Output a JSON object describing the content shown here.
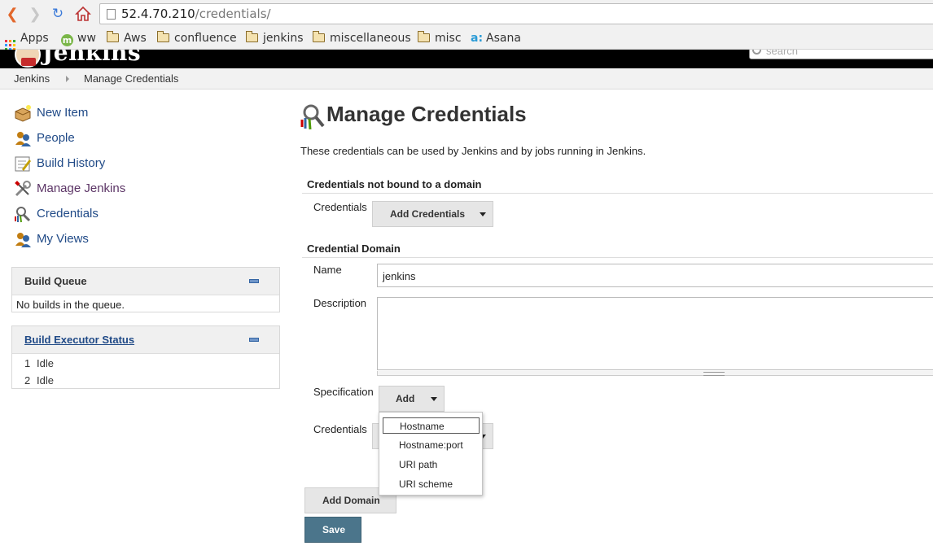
{
  "browser": {
    "url_host": "52.4.70.210",
    "url_path": "/credentials/",
    "bookmarks": [
      {
        "label": "Apps",
        "icon": "apps-grid-icon"
      },
      {
        "label": "ww",
        "icon": "m-icon"
      },
      {
        "label": "Aws",
        "icon": "folder-icon"
      },
      {
        "label": "confluence",
        "icon": "folder-icon"
      },
      {
        "label": "jenkins",
        "icon": "folder-icon"
      },
      {
        "label": "miscellaneous",
        "icon": "folder-icon"
      },
      {
        "label": "misc",
        "icon": "folder-icon"
      },
      {
        "label": "Asana",
        "icon": "asana-icon"
      }
    ]
  },
  "header": {
    "logo_text": "Jenkins",
    "search_placeholder": "search"
  },
  "breadcrumb": {
    "items": [
      "Jenkins",
      "Manage Credentials"
    ]
  },
  "sidebar": {
    "tasks": [
      {
        "label": "New Item",
        "icon": "new-item-icon"
      },
      {
        "label": "People",
        "icon": "people-icon"
      },
      {
        "label": "Build History",
        "icon": "build-history-icon"
      },
      {
        "label": "Manage Jenkins",
        "icon": "manage-jenkins-icon"
      },
      {
        "label": "Credentials",
        "icon": "credentials-icon"
      },
      {
        "label": "My Views",
        "icon": "my-views-icon"
      }
    ],
    "build_queue": {
      "title": "Build Queue",
      "empty_text": "No builds in the queue."
    },
    "executor_status": {
      "title": "Build Executor Status",
      "executors": [
        {
          "number": "1",
          "state": "Idle"
        },
        {
          "number": "2",
          "state": "Idle"
        }
      ]
    }
  },
  "main": {
    "title": "Manage Credentials",
    "intro": "These credentials can be used by Jenkins and by jobs running in Jenkins.",
    "unbound": {
      "heading": "Credentials not bound to a domain",
      "credentials_label": "Credentials",
      "add_credentials_button": "Add Credentials"
    },
    "domain": {
      "heading": "Credential Domain",
      "name_label": "Name",
      "name_value": "jenkins",
      "description_label": "Description",
      "description_value": "",
      "specification_label": "Specification",
      "add_button": "Add",
      "credentials_label": "Credentials",
      "spec_menu": [
        "Hostname",
        "Hostname:port",
        "URI path",
        "URI scheme"
      ]
    },
    "add_domain_button": "Add Domain",
    "save_button": "Save"
  },
  "colors": {
    "save_button": "#4b758b",
    "link": "#204a87",
    "visited_link": "#5c3566",
    "header_bg": "#000000"
  }
}
